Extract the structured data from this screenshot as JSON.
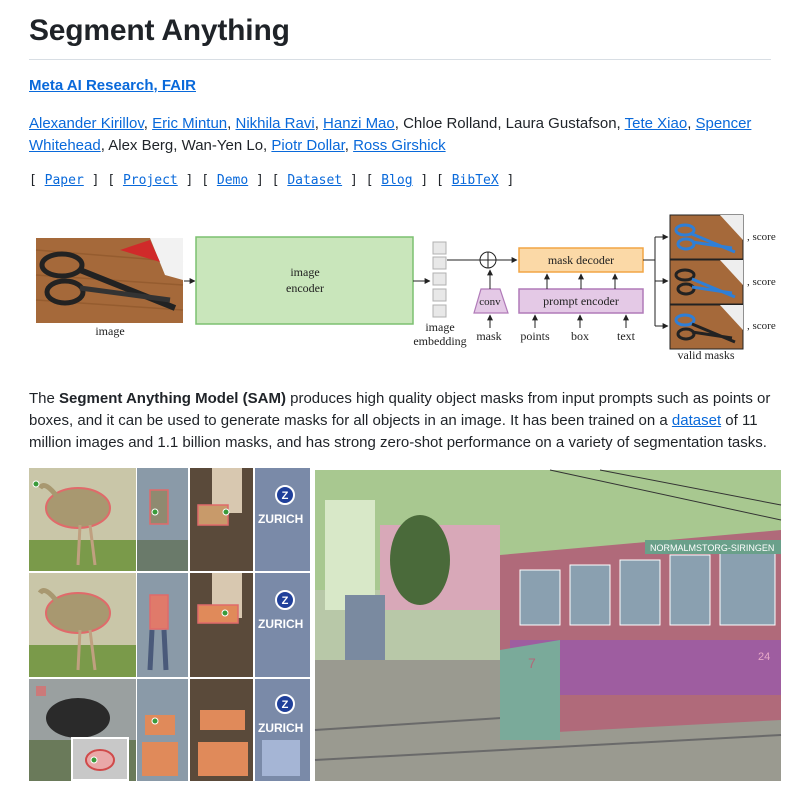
{
  "header": {
    "title": "Segment Anything",
    "org_link": "Meta AI Research, FAIR"
  },
  "authors": {
    "a1": "Alexander Kirillov",
    "a2": "Eric Mintun",
    "a3": "Nikhila Ravi",
    "a4": "Hanzi Mao",
    "plain1": "Chloe Rolland, Laura Gustafson,",
    "a5": "Tete Xiao",
    "a6": "Spencer Whitehead",
    "plain2": "Alex Berg, Wan-Yen Lo,",
    "a7": "Piotr Dollar",
    "a8": "Ross Girshick"
  },
  "links": [
    "Paper",
    "Project",
    "Demo",
    "Dataset",
    "Blog",
    "BibTeX"
  ],
  "diagram": {
    "image_label": "image",
    "encoder_label_1": "image",
    "encoder_label_2": "encoder",
    "embedding_label_1": "image",
    "embedding_label_2": "embedding",
    "conv_label": "conv",
    "mask_label": "mask",
    "mask_decoder_label": "mask decoder",
    "prompt_encoder_label": "prompt encoder",
    "points_label": "points",
    "box_label": "box",
    "text_label": "text",
    "score_1": ", score",
    "score_2": ", score",
    "score_3": ", score",
    "valid_masks_label": "valid masks"
  },
  "description": {
    "intro": "The ",
    "model_name": "Segment Anything Model (SAM)",
    "part1": " produces high quality object masks from input prompts such as points or boxes, and it can be used to generate masks for all objects in an image. It has been trained on a ",
    "dataset_link": "dataset",
    "part2": " of 11 million images and 1.1 billion masks, and has strong zero-shot performance on a variety of segmentation tasks."
  },
  "gallery": {
    "zurich_text": "ZURICH",
    "tram_sign": "NORMALMSTORG-SIRINGEN",
    "tram_number": "24",
    "tram_side_number": "7"
  },
  "colors": {
    "link": "#0969da",
    "encoder_fill": "#c9e6bb",
    "encoder_stroke": "#7cc070",
    "decoder_fill": "#fbd9a7",
    "decoder_stroke": "#f2a545",
    "prompt_fill": "#e4c9e6",
    "prompt_stroke": "#b07ab8"
  }
}
